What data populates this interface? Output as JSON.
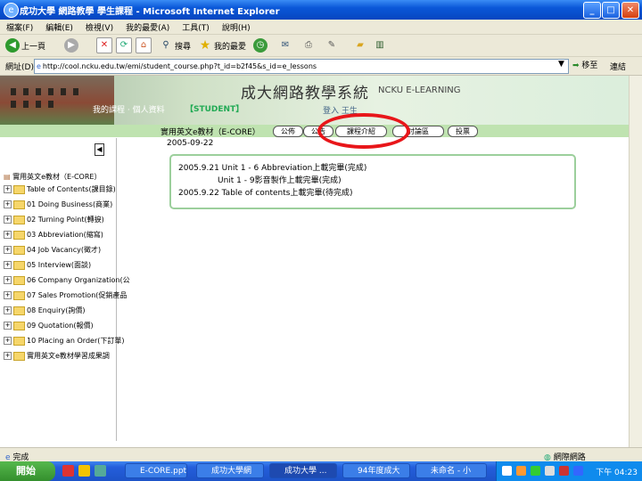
{
  "window": {
    "title": "成功大學 網路教學 學生課程 - Microsoft Internet Explorer",
    "controls": [
      "_",
      "□",
      "✕"
    ]
  },
  "menu": [
    "檔案(F)",
    "編輯(E)",
    "檢視(V)",
    "我的最愛(A)",
    "工具(T)",
    "說明(H)"
  ],
  "toolbar": {
    "back": "上一頁",
    "search": "搜尋",
    "favorites": "我的最愛"
  },
  "address": {
    "label": "網址(D)",
    "url": "http://cool.ncku.edu.tw/emi/student_course.php?t_id=b2f45&s_id=e_lessons",
    "go": "移至",
    "links": "連結"
  },
  "site": {
    "title": "成大網路教學系統",
    "subtitle": "NCKU E-LEARNING",
    "role": "【STUDENT】",
    "top_nav": "我的課程 ‧ 個人資料",
    "user": "登入 王生"
  },
  "course": {
    "title": "實用英文e教材（E-CORE）",
    "nav_buttons": [
      "公佈",
      "公告",
      "課程介紹",
      "討論區",
      "投票"
    ],
    "date": "2005-09-22"
  },
  "notices": [
    "2005.9.21 Unit 1 - 6 Abbreviation上載完畢(完成)",
    "Unit 1 - 9影音製作上載完畢(完成)",
    "2005.9.22 Table of contents上載完畢(待完成)"
  ],
  "tree": {
    "root": "實用英文e教材（E-CORE）",
    "items": [
      "Table of Contents(課目錄)",
      "01 Doing Business(商業)",
      "02 Turning Point(轉捩)",
      "03 Abbreviation(縮寫)",
      "04 Job Vacancy(徵才)",
      "05 Interview(面談)",
      "06 Company Organization(公",
      "07 Sales Promotion(促銷產品",
      "08 Enquiry(詢價)",
      "09 Quotation(報價)",
      "10 Placing an Order(下訂單)",
      "實用英文e教材學習成果調"
    ]
  },
  "status": {
    "text": "完成",
    "zone": "網際網路"
  },
  "taskbar": {
    "start": "開始",
    "tasks": [
      "E-CORE.ppt",
      "成功大學網",
      "成功大學 ...",
      "94年度成大",
      "未命名 - 小"
    ],
    "clock": "下午 04:23"
  }
}
